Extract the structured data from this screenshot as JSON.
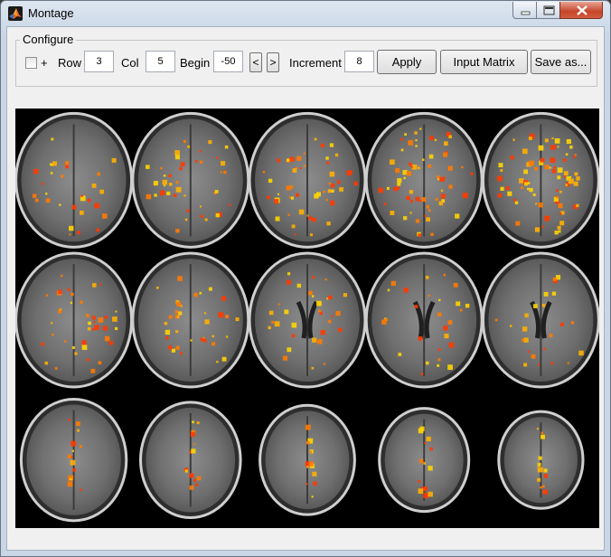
{
  "window": {
    "title": "Montage"
  },
  "configure": {
    "legend": "Configure",
    "checkbox_label": "+",
    "checked": false,
    "row_label": "Row",
    "row_value": "3",
    "col_label": "Col",
    "col_value": "5",
    "begin_label": "Begin",
    "begin_value": "-50",
    "prev_label": "<",
    "next_label": ">",
    "increment_label": "Increment",
    "increment_value": "8",
    "apply_label": "Apply",
    "input_matrix_label": "Input Matrix",
    "save_as_label": "Save as..."
  },
  "montage": {
    "rows": 3,
    "cols": 5,
    "overlay_colors": [
      "#ff3a00",
      "#ff7a00",
      "#ffb000",
      "#ffd400"
    ],
    "background_color": "#000000"
  }
}
